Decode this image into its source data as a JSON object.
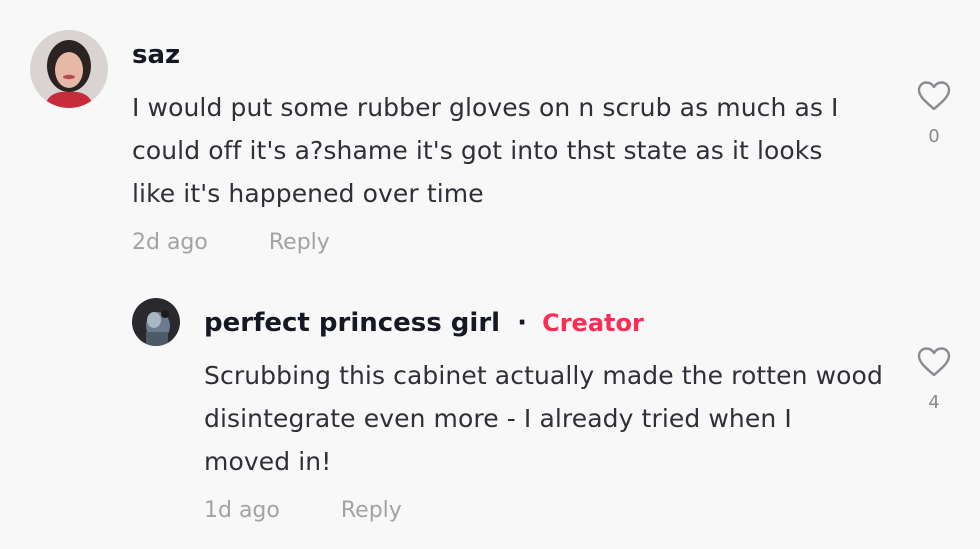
{
  "comments": [
    {
      "username": "saz",
      "text": "I would put some rubber gloves on n scrub as much as I could off it's a?shame it's got into thst state as it looks like it's happened over time",
      "time": "2d ago",
      "reply_label": "Reply",
      "like_count": "0",
      "icon": "heart-outline-icon"
    },
    {
      "username": "perfect princess girl",
      "separator": "·",
      "badge": "Creator",
      "text": "Scrubbing this cabinet actually made the rotten wood disintegrate even more - I already tried when I moved in!",
      "time": "1d ago",
      "reply_label": "Reply",
      "like_count": "4",
      "icon": "heart-outline-icon"
    }
  ],
  "colors": {
    "background": "#f8f8f8",
    "creator_badge": "#fe2c55",
    "meta_text": "#a3a3a7"
  }
}
